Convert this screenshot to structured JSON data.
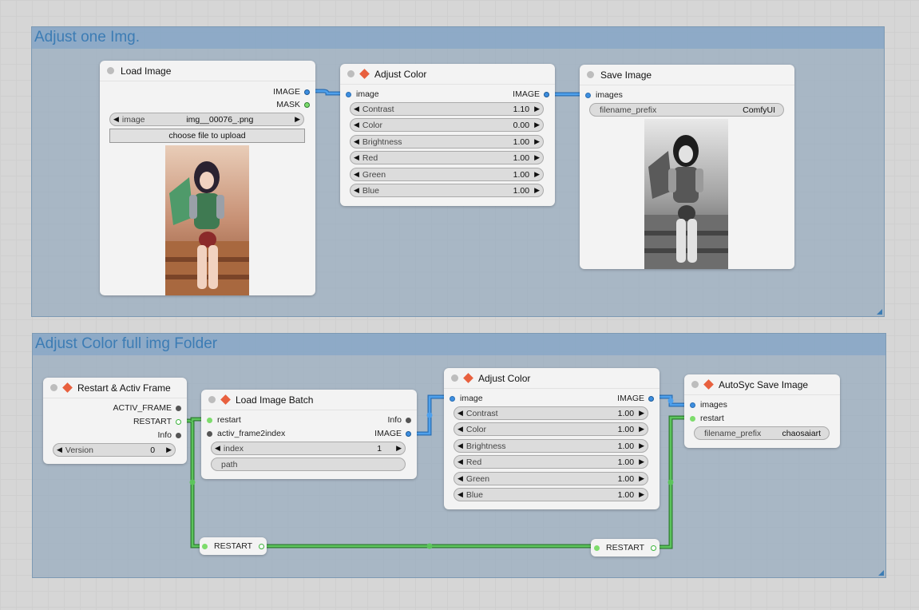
{
  "groups": [
    {
      "title": "Adjust one Img."
    },
    {
      "title": "Adjust Color full img Folder"
    }
  ],
  "colors": {
    "group_title": "#3c7cb4",
    "diamond": "#e8603e",
    "link_blue": "#3d8ee0",
    "link_green": "#3cb43c"
  },
  "load_image": {
    "title": "Load Image",
    "outputs": [
      "IMAGE",
      "MASK"
    ],
    "image_label": "image",
    "image_value": "img__00076_.png",
    "upload_label": "choose file to upload"
  },
  "adjust_color_1": {
    "title": "Adjust Color",
    "input": "image",
    "output": "IMAGE",
    "params": [
      {
        "label": "Contrast",
        "value": "1.10"
      },
      {
        "label": "Color",
        "value": "0.00"
      },
      {
        "label": "Brightness",
        "value": "1.00"
      },
      {
        "label": "Red",
        "value": "1.00"
      },
      {
        "label": "Green",
        "value": "1.00"
      },
      {
        "label": "Blue",
        "value": "1.00"
      }
    ]
  },
  "save_image": {
    "title": "Save Image",
    "input": "images",
    "prefix_label": "filename_prefix",
    "prefix_value": "ComfyUI"
  },
  "restart_frame": {
    "title": "Restart & Activ Frame",
    "outputs": [
      "ACTIV_FRAME",
      "RESTART",
      "Info"
    ],
    "version_label": "Version",
    "version_value": "0"
  },
  "load_batch": {
    "title": "Load Image Batch",
    "inputs": [
      "restart",
      "activ_frame2index"
    ],
    "outputs": [
      "Info",
      "IMAGE"
    ],
    "index_label": "index",
    "index_value": "1",
    "path_label": "path"
  },
  "adjust_color_2": {
    "title": "Adjust Color",
    "input": "image",
    "output": "IMAGE",
    "params": [
      {
        "label": "Contrast",
        "value": "1.00"
      },
      {
        "label": "Color",
        "value": "1.00"
      },
      {
        "label": "Brightness",
        "value": "1.00"
      },
      {
        "label": "Red",
        "value": "1.00"
      },
      {
        "label": "Green",
        "value": "1.00"
      },
      {
        "label": "Blue",
        "value": "1.00"
      }
    ]
  },
  "autosync_save": {
    "title": "AutoSyc Save Image",
    "inputs": [
      "images",
      "restart"
    ],
    "prefix_label": "filename_prefix",
    "prefix_value": "chaosaiart"
  },
  "reroutes": [
    {
      "label": "RESTART"
    },
    {
      "label": "RESTART"
    }
  ]
}
